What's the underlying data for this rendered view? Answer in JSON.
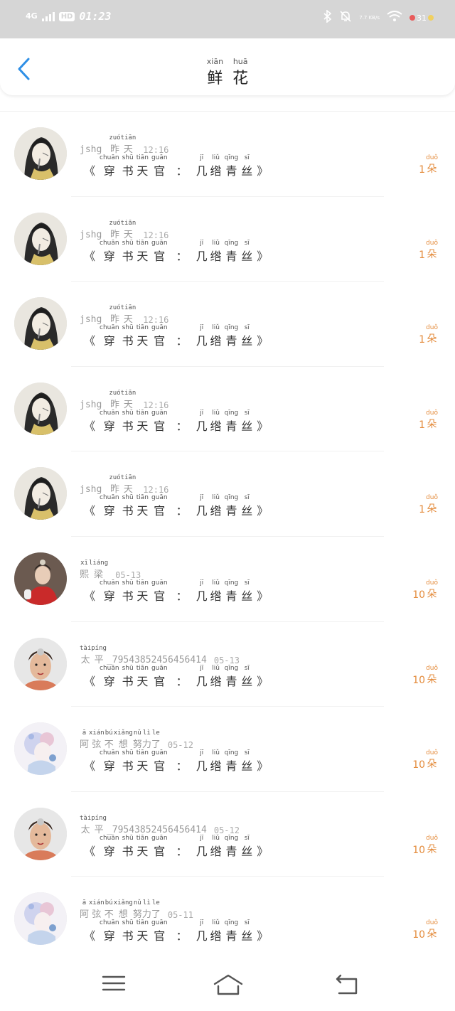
{
  "status": {
    "network": "4G",
    "hd": "HD",
    "time": "01:23",
    "speed": "7.7 KB/s",
    "battery": "31"
  },
  "header": {
    "title_pinyin": [
      "xiān",
      "huā"
    ],
    "title_chars": [
      "鲜",
      "花"
    ]
  },
  "book_title": {
    "open": "《",
    "close": "》",
    "colon": "：",
    "chars": [
      {
        "py": "chuān",
        "hz": "穿"
      },
      {
        "py": "shū",
        "hz": "书"
      },
      {
        "py": "tiān",
        "hz": "天"
      },
      {
        "py": "guān",
        "hz": "官"
      },
      {
        "py": "",
        "hz": "：",
        "sep": true
      },
      {
        "py": "jī",
        "hz": "几"
      },
      {
        "py": "liǔ",
        "hz": "绺"
      },
      {
        "py": "qīng",
        "hz": "青"
      },
      {
        "py": "sī",
        "hz": "丝"
      }
    ]
  },
  "unit": {
    "py": "duǒ",
    "hz": "朵"
  },
  "items": [
    {
      "name": "jshg",
      "time_py": [
        "zuó",
        "tiān"
      ],
      "time_hz": [
        "昨",
        "天"
      ],
      "time": "12:16",
      "count": "1",
      "avatar": "dark-hair"
    },
    {
      "name": "jshg",
      "time_py": [
        "zuó",
        "tiān"
      ],
      "time_hz": [
        "昨",
        "天"
      ],
      "time": "12:16",
      "count": "1",
      "avatar": "dark-hair"
    },
    {
      "name": "jshg",
      "time_py": [
        "zuó",
        "tiān"
      ],
      "time_hz": [
        "昨",
        "天"
      ],
      "time": "12:16",
      "count": "1",
      "avatar": "dark-hair"
    },
    {
      "name": "jshg",
      "time_py": [
        "zuó",
        "tiān"
      ],
      "time_hz": [
        "昨",
        "天"
      ],
      "time": "12:16",
      "count": "1",
      "avatar": "dark-hair"
    },
    {
      "name": "jshg",
      "time_py": [
        "zuó",
        "tiān"
      ],
      "time_hz": [
        "昨",
        "天"
      ],
      "time": "12:16",
      "count": "1",
      "avatar": "dark-hair"
    },
    {
      "name_py": [
        "xī",
        "liáng"
      ],
      "name_hz": [
        "熙",
        "梁"
      ],
      "time": "05-13",
      "count": "10",
      "avatar": "red-dress"
    },
    {
      "name_py": [
        "tài",
        "píng"
      ],
      "name_hz": [
        "太",
        "平"
      ],
      "name_suffix": "_79543852456456414",
      "time": "05-13",
      "count": "10",
      "avatar": "face"
    },
    {
      "name_py": [
        "ā",
        "xián",
        "bú",
        "xiǎng",
        "nǔ",
        "lì",
        "le"
      ],
      "name_hz": [
        "阿",
        "弦",
        "不",
        "想",
        "努",
        "力",
        "了"
      ],
      "time": "05-12",
      "count": "10",
      "avatar": "pastel"
    },
    {
      "name_py": [
        "tài",
        "píng"
      ],
      "name_hz": [
        "太",
        "平"
      ],
      "name_suffix": "_79543852456456414",
      "time": "05-12",
      "count": "10",
      "avatar": "face"
    },
    {
      "name_py": [
        "ā",
        "xián",
        "bú",
        "xiǎng",
        "nǔ",
        "lì",
        "le"
      ],
      "name_hz": [
        "阿",
        "弦",
        "不",
        "想",
        "努",
        "力",
        "了"
      ],
      "time": "05-11",
      "count": "10",
      "avatar": "pastel"
    }
  ]
}
